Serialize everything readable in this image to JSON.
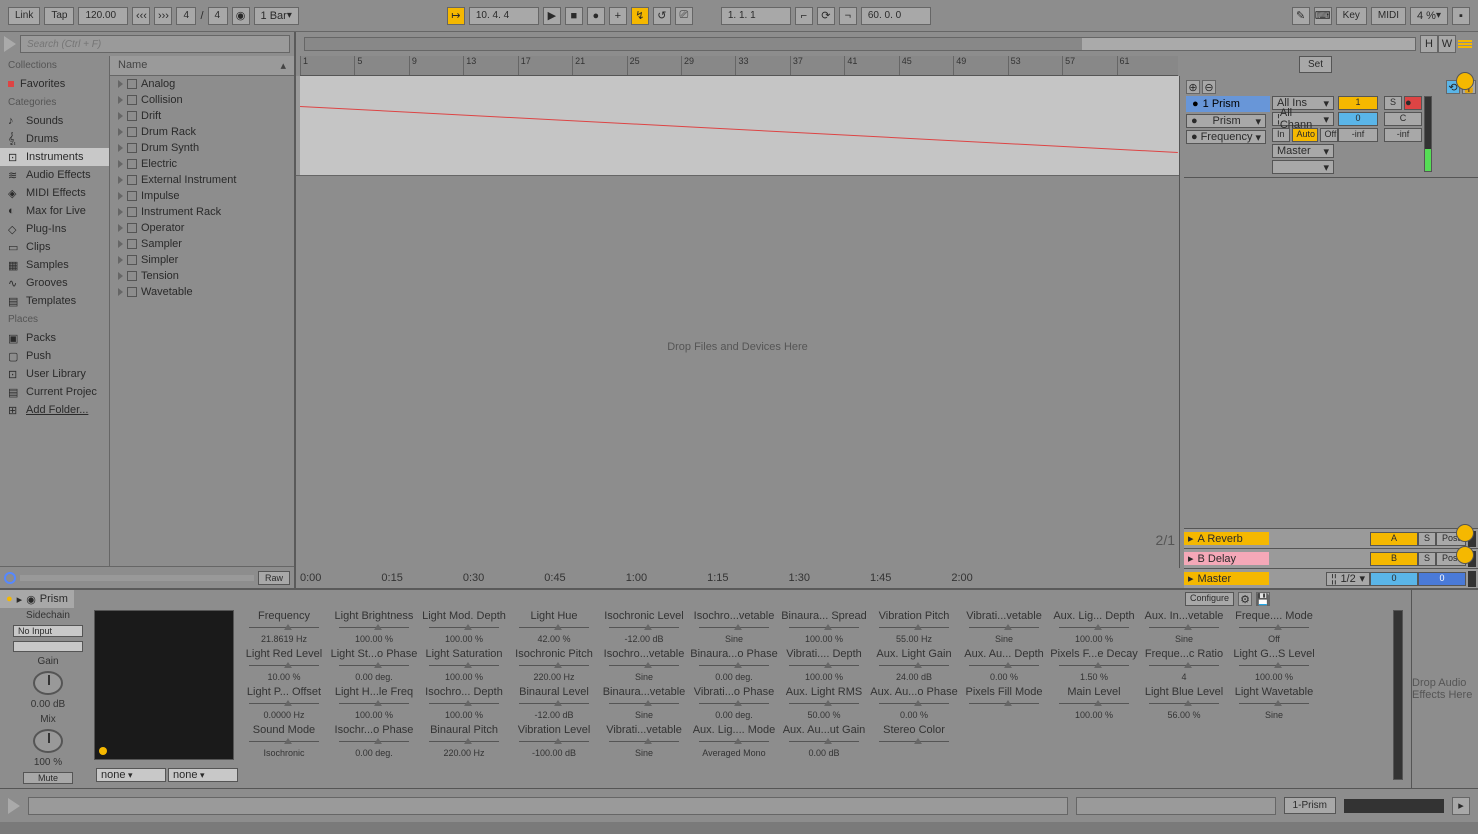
{
  "toolbar": {
    "link": "Link",
    "tap": "Tap",
    "tempo": "120.00",
    "sig_num": "4",
    "sig_den": "4",
    "quantize": "1 Bar",
    "bar_beat": "10.  4.  4",
    "position": "1.  1.  1",
    "loop_length": "60.  0.  0",
    "key": "Key",
    "midi": "MIDI",
    "cpu": "4 %"
  },
  "browser": {
    "search_placeholder": "Search (Ctrl + F)",
    "collections_header": "Collections",
    "favorites": "Favorites",
    "categories_header": "Categories",
    "categories": [
      "Sounds",
      "Drums",
      "Instruments",
      "Audio Effects",
      "MIDI Effects",
      "Max for Live",
      "Plug-Ins",
      "Clips",
      "Samples",
      "Grooves",
      "Templates"
    ],
    "selected_category": "Instruments",
    "places_header": "Places",
    "places": [
      "Packs",
      "Push",
      "User Library",
      "Current Projec",
      "Add Folder..."
    ],
    "name_header": "Name",
    "items": [
      "Analog",
      "Collision",
      "Drift",
      "Drum Rack",
      "Drum Synth",
      "Electric",
      "External Instrument",
      "Impulse",
      "Instrument Rack",
      "Operator",
      "Sampler",
      "Simpler",
      "Tension",
      "Wavetable"
    ],
    "raw": "Raw"
  },
  "arrangement": {
    "ruler_ticks": [
      "1",
      "5",
      "9",
      "13",
      "17",
      "21",
      "25",
      "29",
      "33",
      "37",
      "41",
      "45",
      "49",
      "53",
      "57",
      "61"
    ],
    "drop_hint": "Drop Files and Devices Here",
    "timeline": [
      "0:00",
      "0:15",
      "0:30",
      "0:45",
      "1:00",
      "1:15",
      "1:30",
      "1:45",
      "2:00"
    ],
    "ratio": "2/1",
    "set": "Set"
  },
  "track": {
    "name": "1 Prism",
    "device_dd": "Prism",
    "param_dd": "Frequency",
    "input": "All Ins",
    "channel": "All Chann",
    "output": "Master",
    "in": "In",
    "auto": "Auto",
    "off": "Off",
    "send_a": "1",
    "send_b": "0",
    "s": "S",
    "c": "C",
    "inf1": "-inf",
    "inf2": "-inf"
  },
  "returns": {
    "a": "A Reverb",
    "b": "B Delay",
    "master": "Master",
    "a_btn": "A",
    "b_btn": "B",
    "s": "S",
    "post": "Post",
    "half": "1/2",
    "zero": "0"
  },
  "device": {
    "name": "Prism",
    "sidechain": "Sidechain",
    "no_input": "No Input",
    "gain": "Gain",
    "gain_val": "0.00 dB",
    "mix": "Mix",
    "mix_val": "100 %",
    "mute": "Mute",
    "none": "none",
    "configure": "Configure",
    "drop_fx": "Drop Audio Effects Here",
    "params": [
      {
        "n": "Frequency",
        "v": "21.8619 Hz"
      },
      {
        "n": "Light Brightness",
        "v": "100.00 %"
      },
      {
        "n": "Light Mod. Depth",
        "v": "100.00 %"
      },
      {
        "n": "Light Hue",
        "v": "42.00 %"
      },
      {
        "n": "Isochronic Level",
        "v": "-12.00 dB"
      },
      {
        "n": "Isochro...vetable",
        "v": "Sine"
      },
      {
        "n": "Binaura... Spread",
        "v": "100.00 %"
      },
      {
        "n": "Vibration Pitch",
        "v": "55.00 Hz"
      },
      {
        "n": "Vibrati...vetable",
        "v": "Sine"
      },
      {
        "n": "Aux. Lig... Depth",
        "v": "100.00 %"
      },
      {
        "n": "Aux. In...vetable",
        "v": "Sine"
      },
      {
        "n": "Freque.... Mode",
        "v": "Off"
      },
      {
        "n": "Light Red Level",
        "v": "10.00 %"
      },
      {
        "n": "Light St...o Phase",
        "v": "0.00 deg."
      },
      {
        "n": "Light Saturation",
        "v": "100.00 %"
      },
      {
        "n": "Isochronic Pitch",
        "v": "220.00 Hz"
      },
      {
        "n": "Isochro...vetable",
        "v": "Sine"
      },
      {
        "n": "Binaura...o Phase",
        "v": "0.00 deg."
      },
      {
        "n": "Vibrati.... Depth",
        "v": "100.00 %"
      },
      {
        "n": "Aux. Light Gain",
        "v": "24.00 dB"
      },
      {
        "n": "Aux. Au... Depth",
        "v": "0.00 %"
      },
      {
        "n": "Pixels F...e Decay",
        "v": "1.50 %"
      },
      {
        "n": "Freque...c Ratio",
        "v": "4"
      },
      {
        "n": "Light G...S Level",
        "v": "100.00 %"
      },
      {
        "n": "Light P... Offset",
        "v": "0.0000 Hz"
      },
      {
        "n": "Light H...le Freq",
        "v": "100.00 %"
      },
      {
        "n": "Isochro... Depth",
        "v": "100.00 %"
      },
      {
        "n": "Binaural Level",
        "v": "-12.00 dB"
      },
      {
        "n": "Binaura...vetable",
        "v": "Sine"
      },
      {
        "n": "Vibrati...o Phase",
        "v": "0.00 deg."
      },
      {
        "n": "Aux. Light RMS",
        "v": "50.00 %"
      },
      {
        "n": "Aux. Au...o Phase",
        "v": "0.00 %"
      },
      {
        "n": "Pixels Fill Mode",
        "v": ""
      },
      {
        "n": "Main Level",
        "v": "100.00 %"
      },
      {
        "n": "Light Blue Level",
        "v": "56.00 %"
      },
      {
        "n": "Light Wavetable",
        "v": "Sine"
      },
      {
        "n": "Sound Mode",
        "v": "Isochronic"
      },
      {
        "n": "Isochr...o Phase",
        "v": "0.00 deg."
      },
      {
        "n": "Binaural Pitch",
        "v": "220.00 Hz"
      },
      {
        "n": "Vibration Level",
        "v": "-100.00 dB"
      },
      {
        "n": "Vibrati...vetable",
        "v": "Sine"
      },
      {
        "n": "Aux. Lig.... Mode",
        "v": "Averaged Mono"
      },
      {
        "n": "Aux. Au...ut Gain",
        "v": "0.00 dB"
      },
      {
        "n": "Stereo Color",
        "v": ""
      }
    ]
  },
  "status": {
    "track_label": "1-Prism"
  }
}
